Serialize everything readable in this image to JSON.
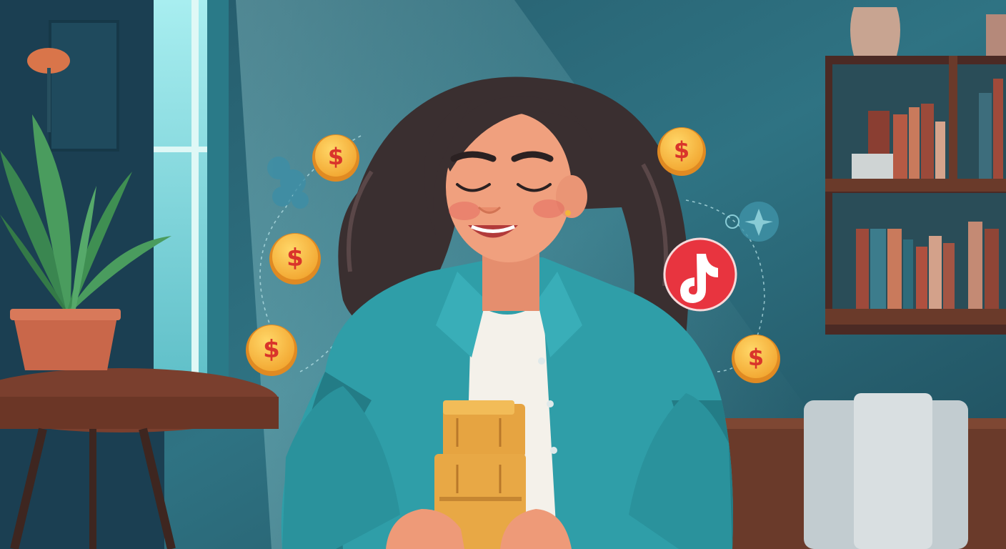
{
  "coin_symbol": "$",
  "palette": {
    "wall": "#2f6f80",
    "wall_dark": "#1b4553",
    "light_beam": "#9fe3e8",
    "jacket": "#2f9ea8",
    "jacket_shadow": "#237c86",
    "shirt": "#f4f1ea",
    "skin": "#f0a07e",
    "hair": "#3a2f30",
    "coin": "#f4b63b",
    "coin_edge": "#e08a22",
    "coin_symbol": "#d9342b",
    "wallet": "#e6a441",
    "shelf_wood": "#6a3a2a",
    "table_wood": "#7a3f2e",
    "plant_leaf": "#3f8f52",
    "pot": "#c9674a",
    "tiktok_bg": "#e8343f"
  },
  "icons": [
    "coin-icon",
    "tiktok-icon",
    "thought-bubble-icon",
    "plant-icon",
    "bookshelf-icon"
  ]
}
